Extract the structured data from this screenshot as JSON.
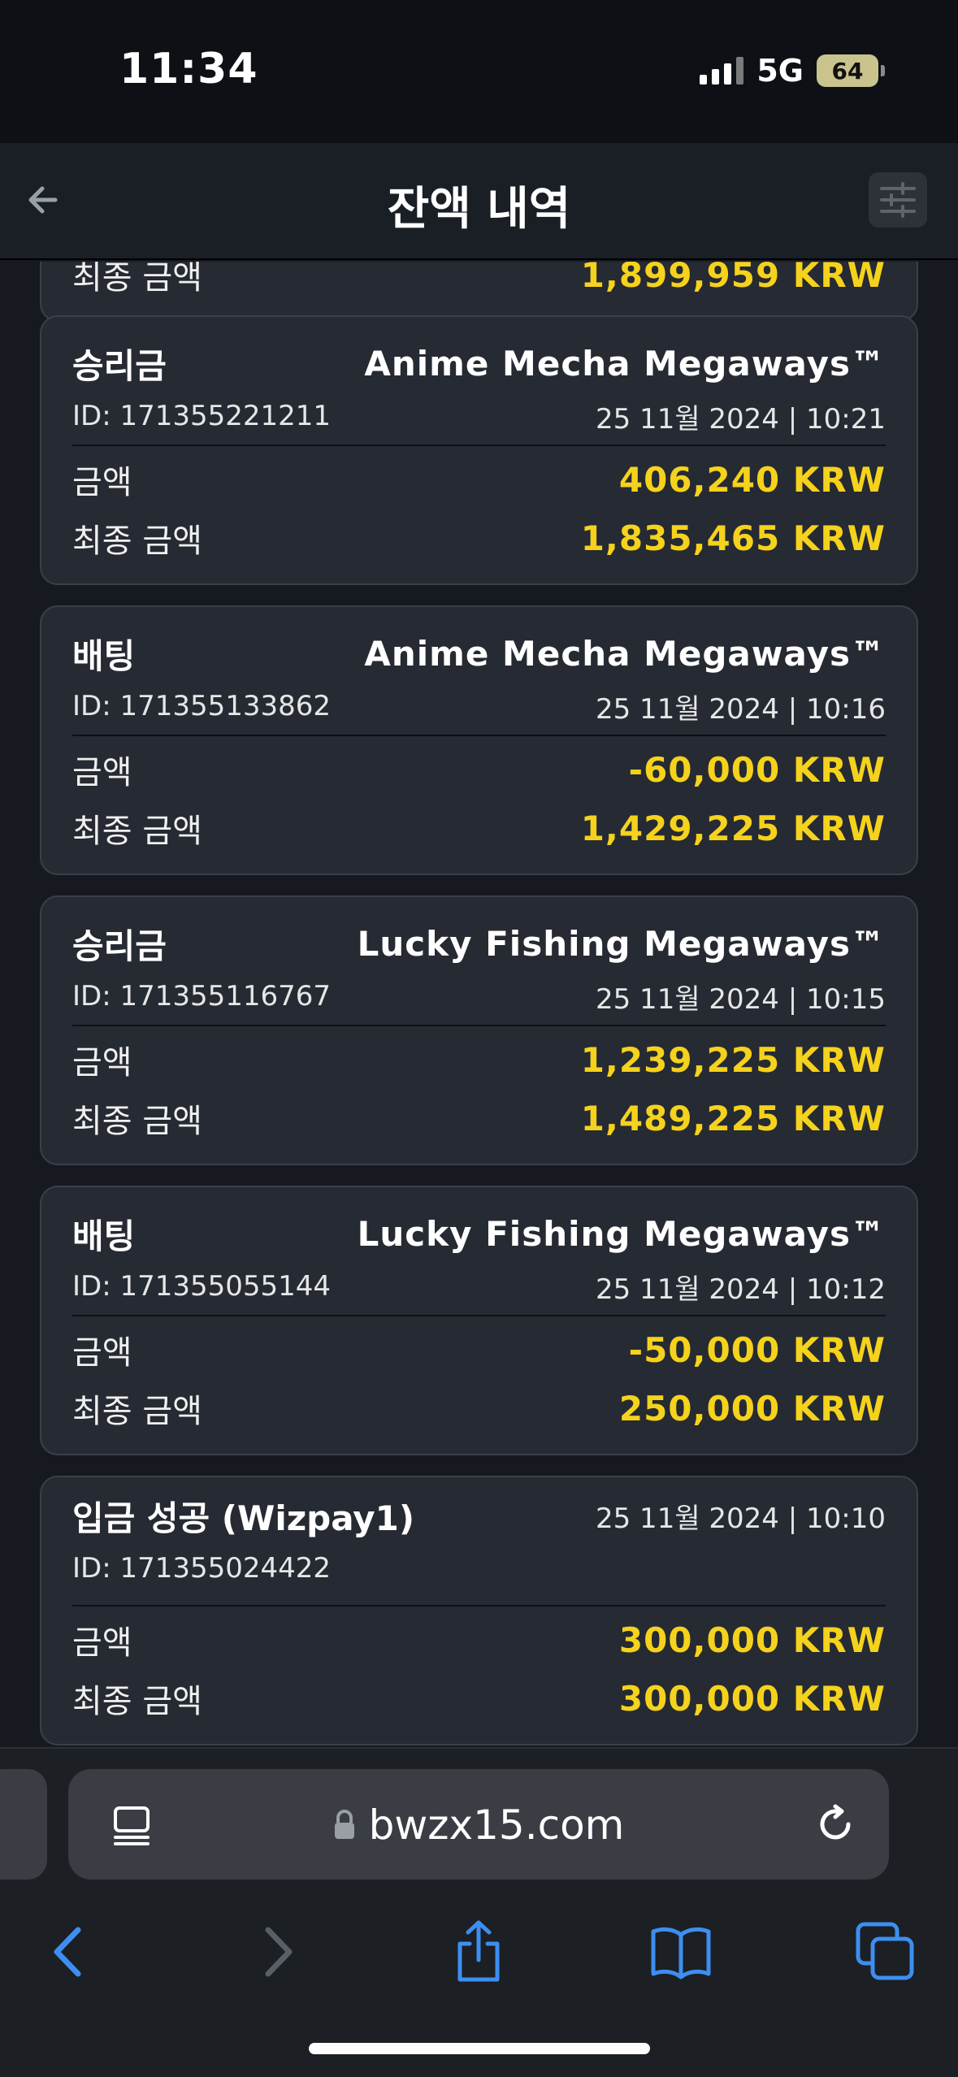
{
  "status": {
    "time": "11:34",
    "network": "5G",
    "battery": "64"
  },
  "header": {
    "title": "잔액 내역"
  },
  "partial_card": {
    "label": "최종 금액",
    "amount": "1,899,959 KRW"
  },
  "transactions": [
    {
      "type": "승리금",
      "game": "Anime Mecha Megaways™",
      "id": "ID: 171355221211",
      "datetime": "25 11월 2024 | 10:21",
      "amount_label": "금액",
      "amount": "406,240 KRW",
      "final_label": "최종 금액",
      "final": "1,835,465 KRW"
    },
    {
      "type": "배팅",
      "game": "Anime Mecha Megaways™",
      "id": "ID: 171355133862",
      "datetime": "25 11월 2024 | 10:16",
      "amount_label": "금액",
      "amount": "-60,000 KRW",
      "final_label": "최종 금액",
      "final": "1,429,225 KRW"
    },
    {
      "type": "승리금",
      "game": "Lucky Fishing Megaways™",
      "id": "ID: 171355116767",
      "datetime": "25 11월 2024 | 10:15",
      "amount_label": "금액",
      "amount": "1,239,225 KRW",
      "final_label": "최종 금액",
      "final": "1,489,225 KRW"
    },
    {
      "type": "배팅",
      "game": "Lucky Fishing Megaways™",
      "id": "ID: 171355055144",
      "datetime": "25 11월 2024 | 10:12",
      "amount_label": "금액",
      "amount": "-50,000 KRW",
      "final_label": "최종 금액",
      "final": "250,000 KRW"
    },
    {
      "type": "입금 성공 (Wizpay1)",
      "game": "",
      "id": "ID: 171355024422",
      "datetime": "25 11월 2024 | 10:10",
      "amount_label": "금액",
      "amount": "300,000 KRW",
      "final_label": "최종 금액",
      "final": "300,000 KRW"
    }
  ],
  "browser": {
    "url": "bwzx15.com"
  },
  "colors": {
    "amount": "#f5d21c",
    "card_bg": "#262a32",
    "page_bg": "#161a20",
    "accent": "#3d8ef0"
  }
}
